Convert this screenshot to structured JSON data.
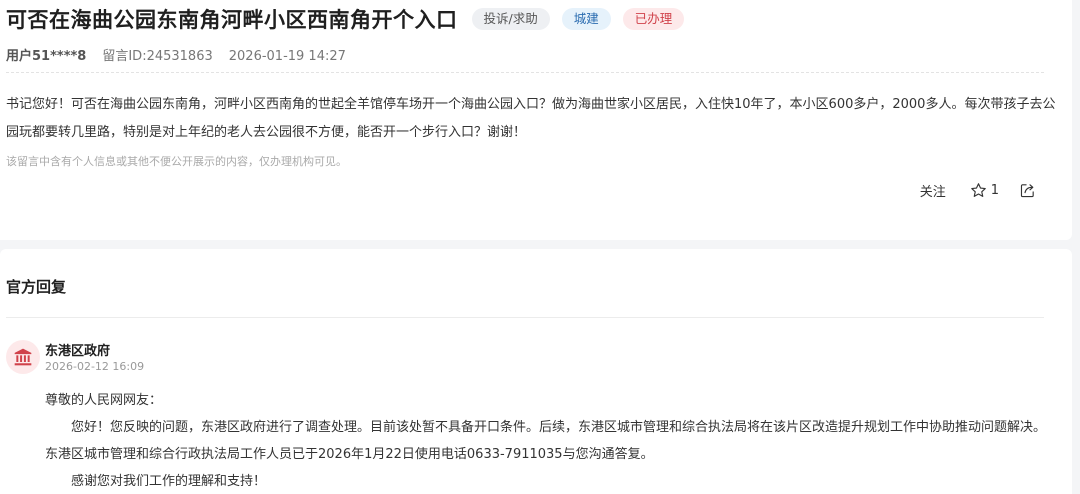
{
  "post": {
    "title": "可否在海曲公园东南角河畔小区西南角开个入口",
    "tags": [
      "投诉/求助",
      "城建",
      "已办理"
    ],
    "user": "用户51****8",
    "message_id": "留言ID:24531863",
    "datetime": "2026-01-19 14:27",
    "content": "书记您好！可否在海曲公园东南角，河畔小区西南角的世起全羊馆停车场开一个海曲公园入口？做为海曲世家小区居民，入住快10年了，本小区600多户，2000多人。每次带孩子去公园玩都要转几里路，特别是对上年纪的老人去公园很不方便，能否开一个步行入口？谢谢！",
    "privacy_notice": "该留言中含有个人信息或其他不便公开展示的内容，仅办理机构可见。",
    "follow_label": "关注",
    "like_count": "1",
    "icons": {
      "star": "star-icon",
      "share": "share-icon"
    }
  },
  "reply": {
    "section_title": "官方回复",
    "org_name": "东港区政府",
    "org_icon": "government-building-icon",
    "date": "2026-02-12 16:09",
    "greeting": "尊敬的人民网网友：",
    "body": "您好！您反映的问题，东港区政府进行了调查处理。目前该处暂不具备开口条件。后续，东港区城市管理和综合执法局将在该片区改造提升规划工作中协助推动问题解决。东港区城市管理和综合行政执法局工作人员已于2026年1月22日使用电话0633-7911035与您沟通答复。",
    "closing": "感谢您对我们工作的理解和支持！"
  },
  "colors": {
    "tag_type_bg": "#eef0f3",
    "tag_category_bg": "#e6f2fb",
    "tag_category_text": "#2b6cb0",
    "tag_status_bg": "#fde9ea",
    "tag_status_text": "#d0424b",
    "avatar_icon": "#d0424b"
  }
}
